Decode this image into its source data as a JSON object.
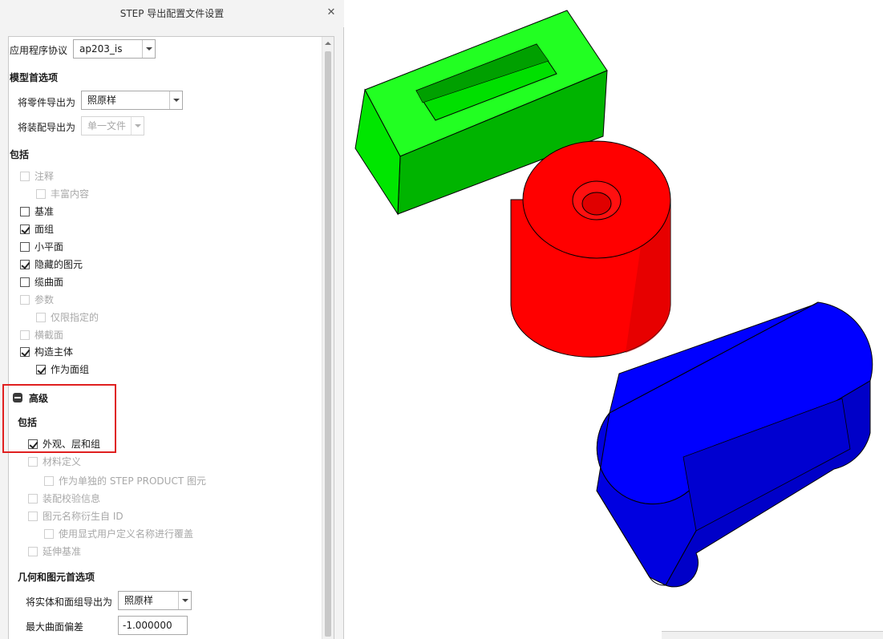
{
  "dialog": {
    "title": "STEP 导出配置文件设置",
    "close_icon": "close-icon",
    "protocol": {
      "label": "应用程序协议",
      "value": "ap203_is"
    },
    "model_prefs": {
      "heading": "模型首选项",
      "part_export": {
        "label": "将零件导出为",
        "value": "照原样"
      },
      "assembly_export": {
        "label": "将装配导出为",
        "value": "单一文件",
        "disabled": true
      }
    },
    "include": {
      "heading": "包括",
      "items": [
        {
          "label": "注释",
          "checked": false,
          "disabled": true
        },
        {
          "label": "丰富内容",
          "checked": false,
          "disabled": true
        },
        {
          "label": "基准",
          "checked": false,
          "disabled": false
        },
        {
          "label": "面组",
          "checked": true,
          "disabled": false
        },
        {
          "label": "小平面",
          "checked": false,
          "disabled": false
        },
        {
          "label": "隐藏的图元",
          "checked": true,
          "disabled": false
        },
        {
          "label": "缆曲面",
          "checked": false,
          "disabled": false
        },
        {
          "label": "参数",
          "checked": false,
          "disabled": true
        },
        {
          "label": "仅限指定的",
          "checked": false,
          "disabled": true
        },
        {
          "label": "横截面",
          "checked": false,
          "disabled": true
        },
        {
          "label": "构造主体",
          "checked": true,
          "disabled": false
        },
        {
          "label": "作为面组",
          "checked": true,
          "disabled": false
        }
      ]
    },
    "advanced": {
      "heading": "高级",
      "include_heading": "包括",
      "items": [
        {
          "label": "外观、层和组",
          "checked": true,
          "disabled": false
        },
        {
          "label": "材料定义",
          "checked": false,
          "disabled": true
        },
        {
          "label": "作为单独的 STEP PRODUCT 图元",
          "checked": false,
          "disabled": true
        },
        {
          "label": "装配校验信息",
          "checked": false,
          "disabled": true
        },
        {
          "label": "图元名称衍生自 ID",
          "checked": false,
          "disabled": true
        },
        {
          "label": "使用显式用户定义名称进行覆盖",
          "checked": false,
          "disabled": true
        },
        {
          "label": "延伸基准",
          "checked": false,
          "disabled": true
        }
      ]
    },
    "geometry": {
      "heading": "几何和图元首选项",
      "export_as": {
        "label": "将实体和面组导出为",
        "value": "照原样"
      },
      "max_deviation": {
        "label": "最大曲面偏差",
        "value": "-1.000000"
      }
    }
  },
  "viewport": {
    "colors": {
      "green": "#00e600",
      "red": "#ff0000",
      "blue": "#0000ff",
      "highlight": "#e02020"
    }
  }
}
